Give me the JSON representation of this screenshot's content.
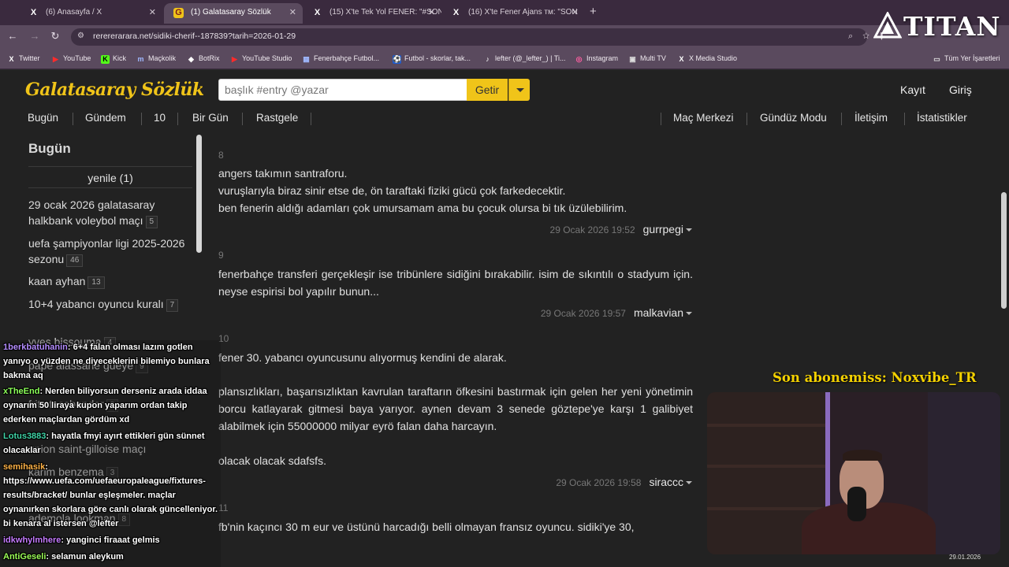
{
  "browser": {
    "tabs": [
      {
        "title": "(6) Anasayfa / X",
        "icon": "X",
        "close": "✕"
      },
      {
        "title": "(1) Galatasaray Sözlük",
        "icon": "G",
        "close": "✕"
      },
      {
        "title": "(15) X'te Tek Yol FENER: \"#SON",
        "icon": "X",
        "close": "✕"
      },
      {
        "title": "(16) X'te Fener Ajans ᴛᴍ: \"SON",
        "icon": "X",
        "close": "✕"
      }
    ],
    "new_tab": "+",
    "url": "rerererarara.net/sidiki-cherif--187839?tarih=2026-01-29",
    "bookmarks": [
      {
        "label": "Twitter",
        "icon": "X"
      },
      {
        "label": "YouTube",
        "icon": "▶"
      },
      {
        "label": "Kick",
        "icon": "K"
      },
      {
        "label": "Maçkolik",
        "icon": "m"
      },
      {
        "label": "BotRix",
        "icon": "◆"
      },
      {
        "label": "YouTube Studio",
        "icon": "▶"
      },
      {
        "label": "Fenerbahçe Futbol...",
        "icon": "▦"
      },
      {
        "label": "Futbol - skorlar, tak...",
        "icon": "⚽"
      },
      {
        "label": "lefter (@_lefter_) | Ti...",
        "icon": "♪"
      },
      {
        "label": "Instagram",
        "icon": "◎"
      },
      {
        "label": "Multi TV",
        "icon": "▣"
      },
      {
        "label": "X Media Studio",
        "icon": "X"
      }
    ],
    "all_bookmarks": "Tüm Yer İşaretleri",
    "colors": {
      "tabbar": "#3a2a3e",
      "toolbar": "#5a4a5e"
    }
  },
  "site": {
    "logo": "Galatasaray Sözlük",
    "search_placeholder": "başlık #entry @yazar",
    "search_button": "Getir",
    "register": "Kayıt",
    "login": "Giriş",
    "nav_left": [
      "Bugün",
      "Gündem",
      "10",
      "Bir Gün",
      "Rastgele"
    ],
    "nav_right": [
      "Maç Merkezi",
      "Gündüz Modu",
      "İletişim",
      "İstatistikler"
    ],
    "accent_color": "#f0c419"
  },
  "sidebar": {
    "title": "Bugün",
    "refresh": "yenile (1)",
    "items": [
      {
        "label": "29 ocak 2026 galatasaray halkbank voleybol maçı",
        "count": "5"
      },
      {
        "label": "uefa şampiyonlar ligi 2025-2026 sezonu",
        "count": "46"
      },
      {
        "label": "kaan ayhan",
        "count": "13"
      },
      {
        "label": "10+4 yabancı oyuncu kuralı",
        "count": "7"
      },
      {
        "label": "yves bissouma",
        "count": "4"
      },
      {
        "label": "pape alassane gueye",
        "count": "9"
      },
      {
        "label": "fritz tassbender",
        "count": "3"
      },
      {
        "label": "union saint-gilloise maçı",
        "count": ""
      },
      {
        "label": "karim benzema",
        "count": "3"
      },
      {
        "label": "ademola lookman",
        "count": "8"
      }
    ]
  },
  "entries": [
    {
      "number": "8",
      "paragraphs": [
        "angers takımın santraforu.\nvuruşlarıyla biraz sinir etse de, ön taraftaki fiziki gücü çok farkedecektir.\nben fenerin aldığı adamları çok umursamam ama bu çocuk olursa bi tık üzülebilirim."
      ],
      "date": "29 Ocak 2026 19:52",
      "author": "gurrpegi"
    },
    {
      "number": "9",
      "paragraphs": [
        "fenerbahçe transferi gerçekleşir ise tribünlere sidiğini bırakabilir. isim de sıkıntılı o stadyum için. neyse espirisi bol yapılır bunun..."
      ],
      "date": "29 Ocak 2026 19:57",
      "author": "malkavian"
    },
    {
      "number": "10",
      "paragraphs": [
        "fener 30. yabancı oyuncusunu alıyormuş kendini de alarak.",
        "plansızlıkları, başarısızlıktan kavrulan taraftarın öfkesini bastırmak için gelen her yeni yönetimin borcu katlayarak gitmesi baya yarıyor. aynen devam 3 senede göztepe'ye karşı 1 galibiyet alabilmek için 55000000 milyar eyrö falan daha harcayın.",
        "olacak olacak sdafsfs."
      ],
      "date": "29 Ocak 2026 19:58",
      "author": "siraccc"
    },
    {
      "number": "11",
      "paragraphs": [
        "fb'nin kaçıncı 30 m eur ve üstünü harcadığı belli olmayan fransız oyuncu. sidiki'ye 30,"
      ],
      "date": "",
      "author": ""
    }
  ],
  "stream": {
    "chat": [
      {
        "user": "1berkbatuhanin",
        "text": ": 6+4 falan olması lazım gotlen yanıyo o yüzden ne diyeceklerini bilemiyo bunlara bakma aq",
        "color": "#b48cff"
      },
      {
        "user": "xTheEnd",
        "text": ": Nerden biliyorsun derseniz arada iddaa oynarım 50 liraya kupon yaparım ordan takip ederken maçlardan gördüm xd",
        "color": "#8cff5a"
      },
      {
        "user": "Lotus3883",
        "text": ": hayatla fmyi ayırt ettikleri gün sünnet olacaklar",
        "color": "#3fd3a6"
      },
      {
        "user": "semihasik",
        "text": ": https://www.uefa.com/uefaeuropaleague/fixtures-results/bracket/ bunlar eşleşmeler. maçlar oynanırken skorlara göre canlı olarak güncelleniyor. bi kenara al istersen @lefter",
        "color": "#ffb347"
      },
      {
        "user": "idkwhylmhere",
        "text": ": yanginci firaaat gelmis",
        "color": "#c57bff"
      },
      {
        "user": "AntiGeseli",
        "text": ": selamun aleykum",
        "color": "#9cff57"
      }
    ],
    "sub_banner": "Son abonemiss: Noxvibe_TR",
    "brand": "TITAN",
    "taskbar_date": "29.01.2026"
  }
}
